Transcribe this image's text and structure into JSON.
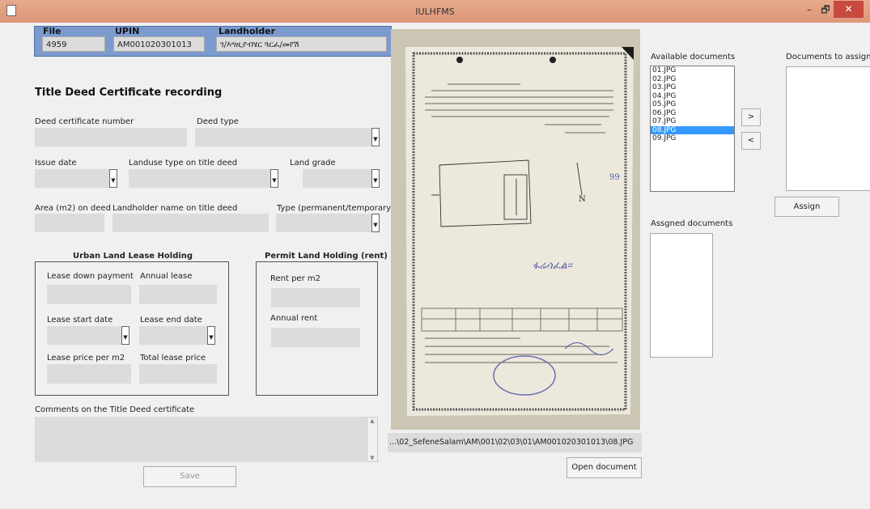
{
  "window": {
    "title": "IULHFMS",
    "minimize": "–",
    "maximize": "🗗",
    "close": "✕"
  },
  "header": {
    "file_label": "File",
    "file_value": "4959",
    "upin_label": "UPIN",
    "upin_value": "AM001020301013",
    "landholder_label": "Landholder",
    "landholder_value": "ገ/እግዚያብሄር ጓርፈ/መየሽ"
  },
  "form": {
    "section_title": "Title Deed Certificate recording",
    "deed_number_label": "Deed certificate number",
    "deed_type_label": "Deed type",
    "issue_date_label": "Issue date",
    "landuse_label": "Landuse type on title deed",
    "land_grade_label": "Land grade",
    "area_label": "Area (m2) on deed",
    "landholder_name_label": "Landholder name on title deed",
    "type_label": "Type (permanent/temporary)",
    "comments_label": "Comments on the Title Deed certificate",
    "save_label": "Save"
  },
  "lease": {
    "title": "Urban Land Lease Holding",
    "down_payment_label": "Lease down payment",
    "annual_lease_label": "Annual lease",
    "start_date_label": "Lease start date",
    "end_date_label": "Lease end date",
    "price_per_m2_label": "Lease price per m2",
    "total_price_label": "Total lease price"
  },
  "permit": {
    "title": "Permit Land Holding (rent)",
    "rent_per_m2_label": "Rent per m2",
    "annual_rent_label": "Annual rent"
  },
  "document": {
    "path": "...\\02_SefeneSalam\\AM\\001\\02\\03\\01\\AM001020301013\\08.JPG",
    "open_label": "Open document",
    "stamp_text": "ፋሬሳፈል።"
  },
  "documents": {
    "available_label": "Available documents",
    "to_assign_label": "Documents to assign",
    "assigned_label": "Assgned documents",
    "assign_label": "Assign",
    "move_right_label": ">",
    "move_left_label": "<",
    "available": [
      "01.JPG",
      "02.JPG",
      "03.JPG",
      "04.JPG",
      "05.JPG",
      "06.JPG",
      "07.JPG",
      "08.JPG",
      "09.JPG"
    ],
    "selected": "08.JPG"
  },
  "colors": {
    "header_panel": "#7b9bcf",
    "titlebar": "#e0997a",
    "selection": "#3399ff",
    "close": "#c74a3f"
  }
}
